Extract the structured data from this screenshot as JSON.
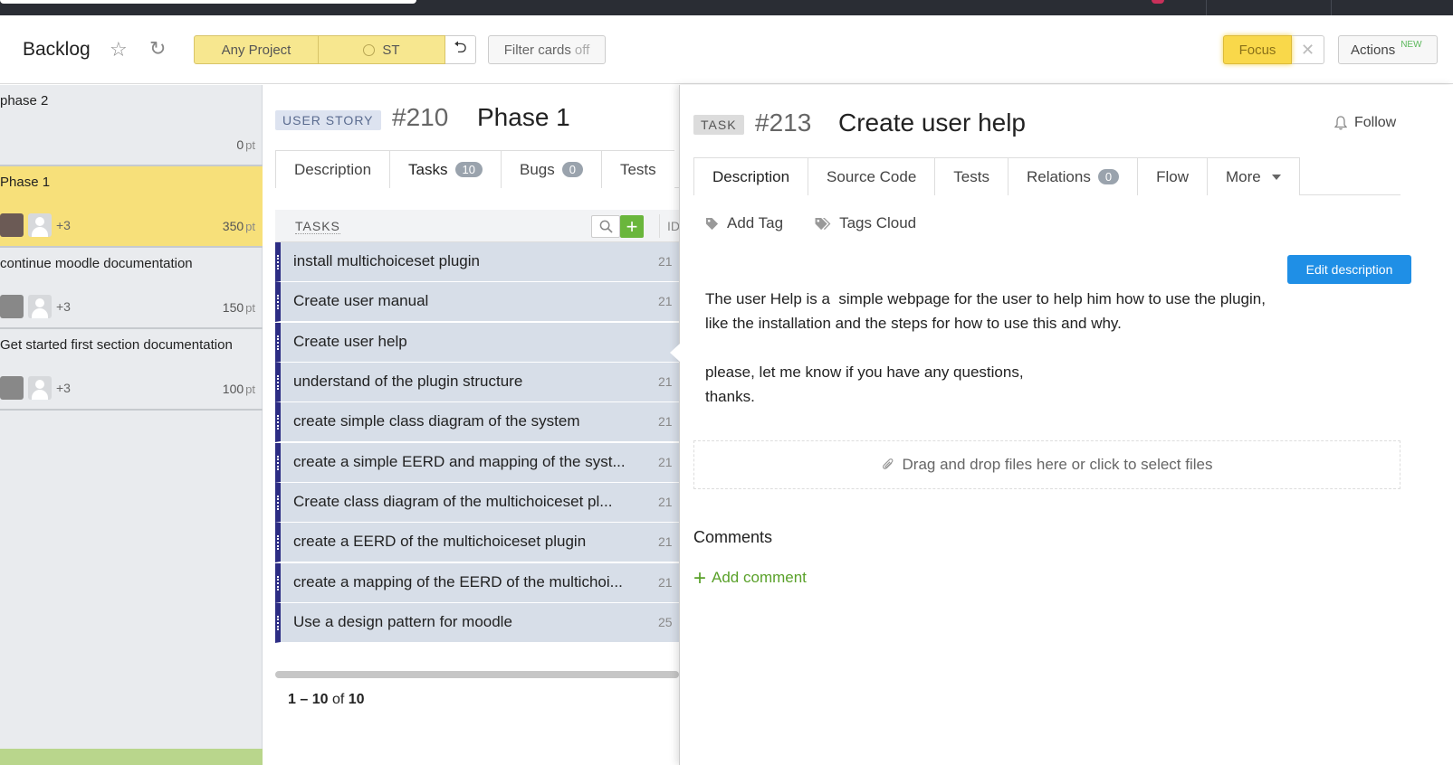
{
  "header": {
    "title": "Backlog",
    "project_filter": "Any Project",
    "team_filter": "ST",
    "filter_cards_label": "Filter cards",
    "filter_cards_state": "off",
    "focus_label": "Focus",
    "actions_label": "Actions",
    "actions_badge": "NEW"
  },
  "backlog": {
    "cards": [
      {
        "name": "phase 2",
        "points": "0",
        "unit": "pt",
        "extra": ""
      },
      {
        "name": "Phase 1",
        "points": "350",
        "unit": "pt",
        "extra": "+3",
        "highlight": true
      },
      {
        "name": "continue moodle documentation",
        "points": "150",
        "unit": "pt",
        "extra": "+3"
      },
      {
        "name": "Get started first section documentation",
        "points": "100",
        "unit": "pt",
        "extra": "+3"
      }
    ]
  },
  "story": {
    "type_badge": "USER STORY",
    "number": "#210",
    "title": "Phase 1",
    "tabs": [
      {
        "label": "Description"
      },
      {
        "label": "Tasks",
        "count": "10"
      },
      {
        "label": "Bugs",
        "count": "0"
      },
      {
        "label": "Tests"
      }
    ],
    "tasks_header": "TASKS",
    "id_header": "ID",
    "tasks": [
      {
        "name": "install multichoiceset plugin",
        "id": "21"
      },
      {
        "name": "Create user manual",
        "id": "21"
      },
      {
        "name": "Create user help",
        "id": ""
      },
      {
        "name": "understand of the plugin structure",
        "id": "21"
      },
      {
        "name": "create simple class diagram of the system",
        "id": "21"
      },
      {
        "name": "create a simple EERD and mapping of the syst...",
        "id": "21"
      },
      {
        "name": "Create class diagram of the multichoiceset pl...",
        "id": "21"
      },
      {
        "name": "create a EERD of the multichoiceset plugin",
        "id": "21"
      },
      {
        "name": "create a mapping of the EERD of the multichoi...",
        "id": "21"
      },
      {
        "name": "Use a design pattern for moodle",
        "id": "25"
      }
    ],
    "pager": {
      "range": "1 – 10",
      "of": "of",
      "total": "10"
    }
  },
  "task": {
    "type_badge": "TASK",
    "number": "#213",
    "title": "Create user help",
    "follow_label": "Follow",
    "tabs": [
      {
        "label": "Description"
      },
      {
        "label": "Source Code"
      },
      {
        "label": "Tests"
      },
      {
        "label": "Relations",
        "count": "0"
      },
      {
        "label": "Flow"
      },
      {
        "label": "More"
      }
    ],
    "add_tag_label": "Add Tag",
    "tags_cloud_label": "Tags Cloud",
    "edit_description_label": "Edit description",
    "description_p1": "The user Help is a  simple webpage for the user to help him how to use the plugin,\nlike the installation and the steps for how to use this and why.",
    "description_p2": "please, let me know if you have any questions,\nthanks.",
    "dropzone_label": "Drag and drop files here or click to select files",
    "comments_heading": "Comments",
    "add_comment_label": "Add comment"
  },
  "colors": {
    "highlight_card": "#f7e07a",
    "task_row": "#d7dee8",
    "task_marker": "#2d2d84",
    "primary_button": "#1f8fe6",
    "add_green": "#5aa12a"
  }
}
